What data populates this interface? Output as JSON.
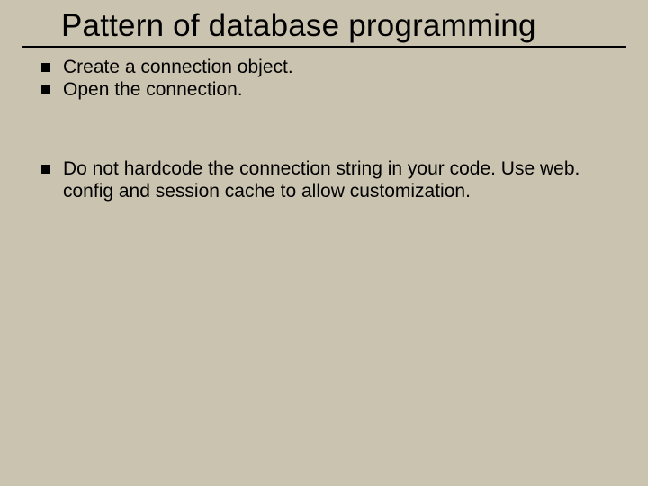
{
  "title": "Pattern of database programming",
  "group1": {
    "items": [
      "Create a connection object.",
      "Open the connection."
    ]
  },
  "group2": {
    "items": [
      "Do not hardcode the connection string in your code. Use web. config and session cache to allow customization."
    ]
  }
}
